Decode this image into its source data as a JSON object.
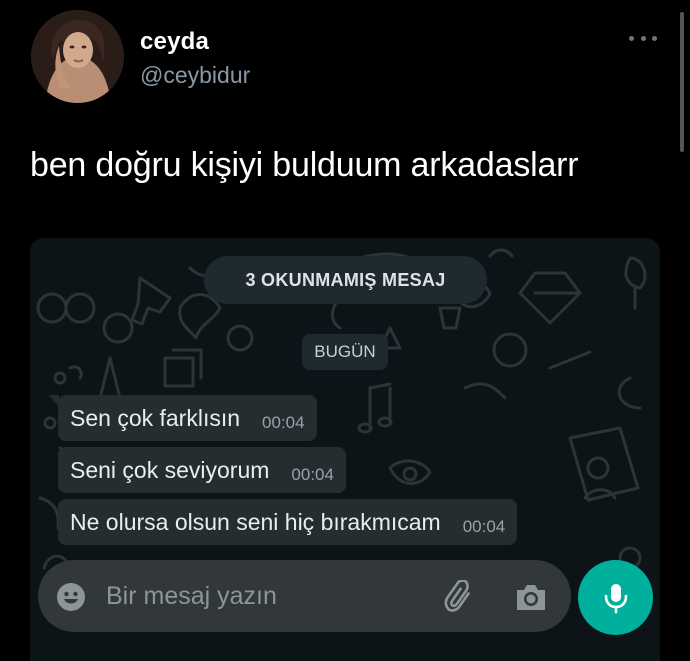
{
  "tweet": {
    "display_name": "ceyda",
    "handle": "@ceybidur",
    "text": "ben doğru kişiyi bulduum arkadaslarr",
    "avatar_icon": "profile-photo",
    "more_icon": "more-horizontal-icon"
  },
  "chat": {
    "unread_banner": "3 OKUNMAMIŞ MESAJ",
    "date_label": "BUGÜN",
    "messages": [
      {
        "text": "Sen çok farklısın",
        "time": "00:04"
      },
      {
        "text": "Seni çok seviyorum",
        "time": "00:04"
      },
      {
        "text": "Ne olursa olsun seni hiç bırakmıcam",
        "time": "00:04"
      }
    ],
    "composer": {
      "placeholder": "Bir mesaj yazın",
      "value": ""
    }
  },
  "colors": {
    "background": "#000000",
    "chat_background": "#0d1418",
    "bubble": "#262d31",
    "pill": "#1e2a30",
    "composer": "#323739",
    "mic_button": "#00af9c",
    "handle_text": "#8b98a5"
  }
}
